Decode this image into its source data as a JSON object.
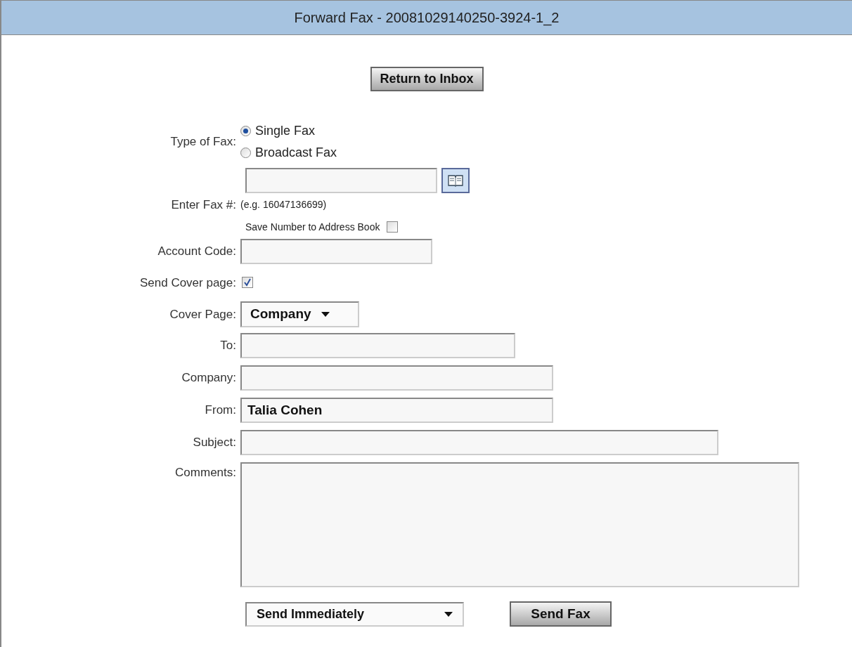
{
  "title": "Forward Fax - 20081029140250-3924-1_2",
  "return_button": "Return to Inbox",
  "fields": [
    {
      "kind": "radio",
      "label": "Type of Fax:",
      "options": [
        {
          "label": "Single Fax",
          "selected": true
        },
        {
          "label": "Broadcast Fax",
          "selected": false
        }
      ]
    },
    {
      "kind": "fax",
      "label": "Enter Fax #:",
      "hint": "(e.g. 16047136699)",
      "save_label": "Save Number to Address Book",
      "save_checked": false
    },
    {
      "kind": "text",
      "label": "Account Code:"
    },
    {
      "kind": "checkbox",
      "label": "Send Cover page:",
      "checked": true
    },
    {
      "kind": "select",
      "label": "Cover Page:",
      "value": "Company"
    },
    {
      "kind": "text",
      "label": "To:"
    },
    {
      "kind": "text",
      "label": "Company:"
    },
    {
      "kind": "text",
      "label": "From:",
      "value": "Talia Cohen"
    },
    {
      "kind": "text",
      "label": "Subject:"
    },
    {
      "kind": "textarea",
      "label": "Comments:"
    }
  ],
  "footer": {
    "schedule": "Send Immediately",
    "send_button": "Send Fax"
  }
}
